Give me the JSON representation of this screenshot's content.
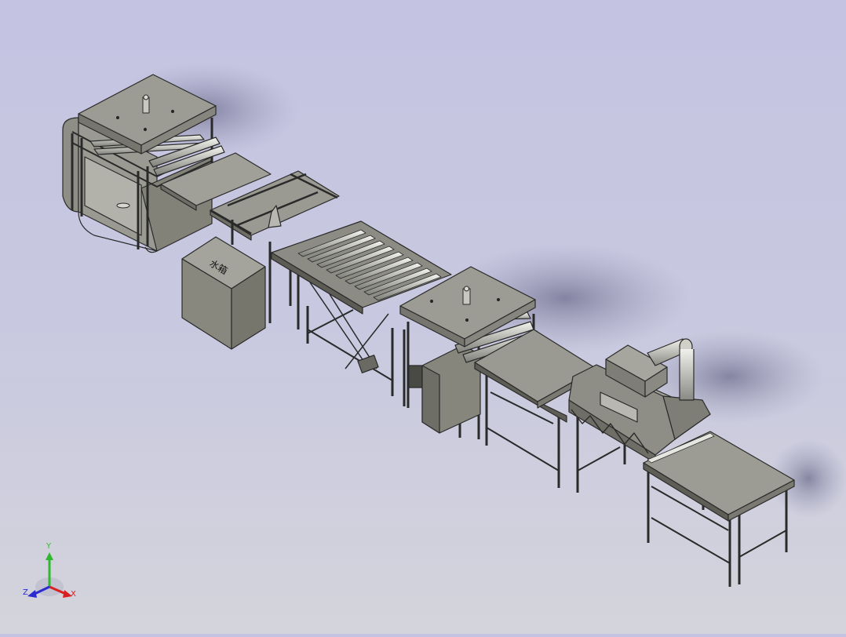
{
  "viewport": {
    "background_top": "#c4c4e2",
    "background_bottom": "#d4d4dc",
    "part_color": "#8e8e86",
    "edge_color": "#2a2a2a"
  },
  "machines": {
    "top_left_unit": {
      "label": "",
      "icon": "printing-unit"
    },
    "water_tank": {
      "label": "水箱",
      "icon": "tank"
    },
    "roller_conveyor": {
      "icon": "roller-conveyor"
    },
    "middle_unit": {
      "label": "",
      "icon": "coating-unit"
    },
    "dryer": {
      "label": "",
      "icon": "uv-dryer"
    },
    "exit_table": {
      "icon": "outfeed-table"
    }
  },
  "triad": {
    "x_label": "X",
    "y_label": "Y",
    "z_label": "Z",
    "x_color": "#d82020",
    "y_color": "#2db82d",
    "z_color": "#2a2ad0"
  }
}
